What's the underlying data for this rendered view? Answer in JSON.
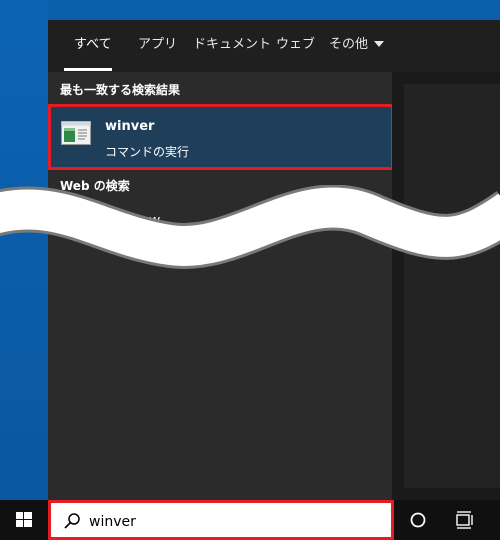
{
  "tabs": [
    {
      "label": "すべて",
      "active": true
    },
    {
      "label": "アプリ"
    },
    {
      "label": "ドキュメント"
    },
    {
      "label": "ウェブ"
    },
    {
      "label": "その他"
    }
  ],
  "sections": {
    "best_match": "最も一致する検索結果",
    "web": "Web の検索"
  },
  "best_match_result": {
    "title": "winver",
    "subtitle": "コマンドの実行",
    "icon": "winver-app-icon"
  },
  "web_result": {
    "text": "winver - w",
    "icon": "search-icon",
    "arrow_icon": "chevron-right-icon"
  },
  "taskbar": {
    "search_value": "winver",
    "icons": [
      "windows-start-icon",
      "search-icon",
      "cortana-icon",
      "task-view-icon"
    ]
  },
  "colors": {
    "desktop": "#0b5eaa",
    "panel": "#2b2b2b",
    "tab_bar": "#1f1f1f",
    "selected_result": "#1f3e5a",
    "highlight_border": "#e51c23",
    "taskbar": "#101010"
  }
}
